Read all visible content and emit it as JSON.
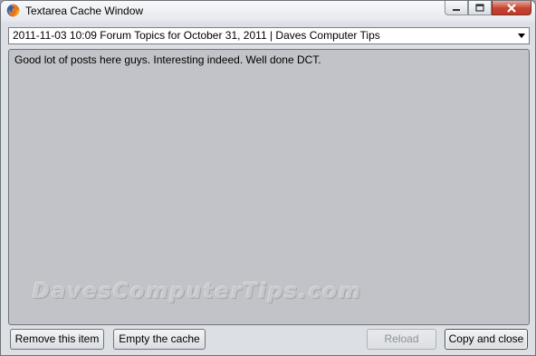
{
  "window": {
    "title": "Textarea Cache Window",
    "icon": "firefox-icon",
    "controls": [
      "minimize-icon",
      "maximize-icon",
      "close-icon"
    ]
  },
  "entry_select": {
    "selected": "2011-11-03 10:09  Forum Topics for October 31, 2011 | Daves Computer Tips"
  },
  "textarea": {
    "value": "Good lot of posts here guys. Interesting indeed. Well done DCT.",
    "watermark": "DavesComputerTips.com"
  },
  "buttons": {
    "remove": "Remove this item",
    "empty": "Empty the cache",
    "reload": "Reload",
    "copy_close": "Copy and close"
  },
  "colors": {
    "textarea_bg": "#c2c3c8",
    "close_button": "#c5432f"
  }
}
